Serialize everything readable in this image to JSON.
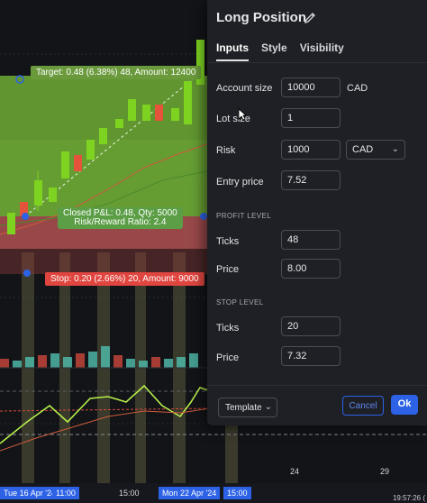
{
  "colors": {
    "accent": "#2d62e6",
    "profit_zone": "#7ec83a",
    "loss_zone": "#e06464",
    "candle_up": "#7ed321",
    "candle_down": "#e5533a",
    "dialog_bg": "#1e2025"
  },
  "chart": {
    "target_label": "Target: 0.48 (6.38%) 48, Amount: 12400",
    "stop_label": "Stop: 0.20 (2.66%) 20, Amount: 9000",
    "pnl_line1": "Closed P&L: 0.48, Qty: 5000",
    "pnl_line2": "Risk/Reward Ratio: 2.4",
    "time_ticks": [
      "Tue 16 Apr '24",
      "11:00",
      "15:00",
      "Mon 22 Apr '24",
      "15:00",
      "24",
      "29"
    ],
    "time_ticks_selected": [
      true,
      false,
      false,
      true,
      true,
      false,
      false
    ],
    "clock": "19:57:26 (",
    "cursor_icon": "text-cursor-icon"
  },
  "dialog": {
    "title": "Long Position",
    "edit_icon": "pencil-icon",
    "tabs": [
      {
        "label": "Inputs",
        "active": true
      },
      {
        "label": "Style",
        "active": false
      },
      {
        "label": "Visibility",
        "active": false
      }
    ],
    "account_size": {
      "label": "Account size",
      "value": "10000",
      "unit": "CAD"
    },
    "lot_size": {
      "label": "Lot size",
      "value": "1"
    },
    "risk": {
      "label": "Risk",
      "value": "1000",
      "unit_select": "CAD"
    },
    "entry_price": {
      "label": "Entry price",
      "value": "7.52"
    },
    "profit_section": "PROFIT LEVEL",
    "profit_ticks": {
      "label": "Ticks",
      "value": "48"
    },
    "profit_price": {
      "label": "Price",
      "value": "8.00"
    },
    "stop_section": "STOP LEVEL",
    "stop_ticks": {
      "label": "Ticks",
      "value": "20"
    },
    "stop_price": {
      "label": "Price",
      "value": "7.32"
    },
    "template_button": "Template",
    "cancel_button": "Cancel",
    "ok_button": "Ok"
  }
}
